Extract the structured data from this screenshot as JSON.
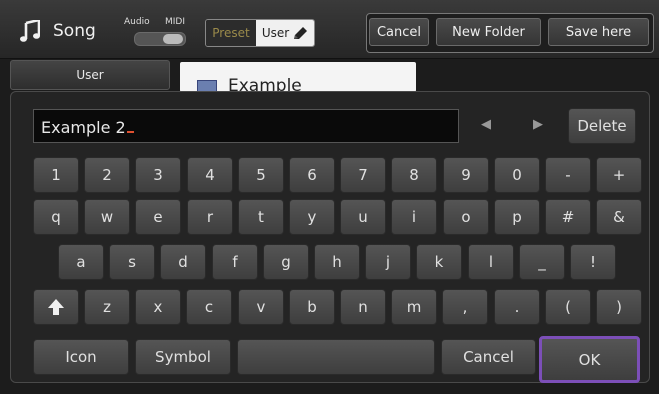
{
  "header": {
    "title": "Song",
    "audio_label": "Audio",
    "midi_label": "MIDI",
    "preset_label": "Preset",
    "user_label": "User",
    "cancel_label": "Cancel",
    "new_folder_label": "New Folder",
    "save_here_label": "Save here"
  },
  "side_tab": {
    "label": "User"
  },
  "file": {
    "name": "Example"
  },
  "keyboard": {
    "input_value": "Example 2",
    "delete_label": "Delete",
    "row1": [
      "1",
      "2",
      "3",
      "4",
      "5",
      "6",
      "7",
      "8",
      "9",
      "0",
      "-",
      "+"
    ],
    "row2": [
      "q",
      "w",
      "e",
      "r",
      "t",
      "y",
      "u",
      "i",
      "o",
      "p",
      "#",
      "&"
    ],
    "row3": [
      "a",
      "s",
      "d",
      "f",
      "g",
      "h",
      "j",
      "k",
      "l",
      "_",
      "!"
    ],
    "row4": [
      "z",
      "x",
      "c",
      "v",
      "b",
      "n",
      "m",
      ",",
      ".",
      "(",
      ")"
    ],
    "icon_label": "Icon",
    "symbol_label": "Symbol",
    "cancel_label": "Cancel",
    "ok_label": "OK"
  },
  "colors": {
    "accent_ok_border": "#7c4fb8",
    "preset_text": "#9a8a4a",
    "cursor": "#e05030"
  }
}
